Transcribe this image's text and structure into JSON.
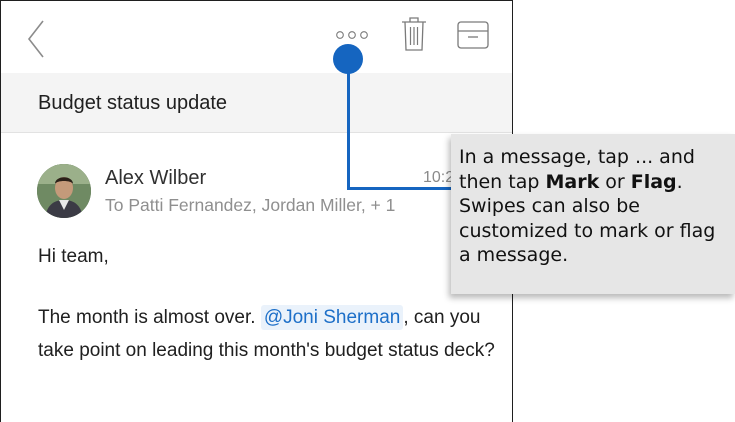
{
  "message": {
    "subject": "Budget status update",
    "sender": "Alex Wilber",
    "time": "10:2",
    "recipients": "To Patti Fernandez, Jordan Miller, + 1",
    "greeting": "Hi team,",
    "body_before": "The month is almost over. ",
    "mention": "@Joni Sherman",
    "body_after": ", can you take point on leading this month's budget status deck?"
  },
  "tooltip": {
    "part1": "In a message, tap ... and then tap ",
    "mark": "Mark",
    "part2": " or ",
    "flag": "Flag",
    "part3": ". Swipes can also be customized to mark or flag a message."
  },
  "icons": {
    "back": "chevron-left-icon",
    "more": "more-dots-icon",
    "trash": "trash-icon",
    "archive": "archive-icon"
  },
  "colors": {
    "accent": "#1565c0",
    "mention": "#1d6fc8",
    "subject_bar": "#f4f4f4",
    "tooltip_bg": "#e6e6e6"
  }
}
